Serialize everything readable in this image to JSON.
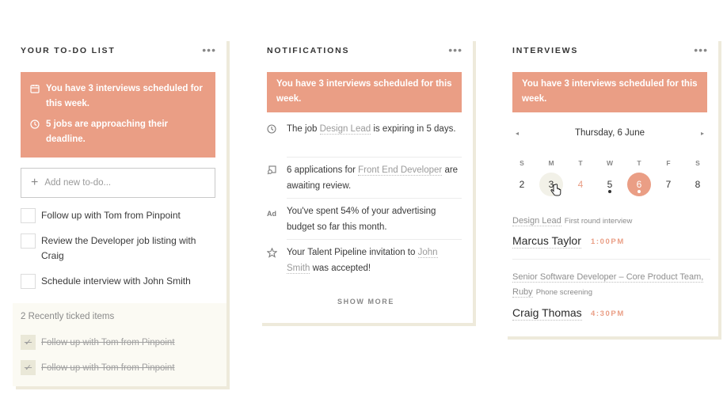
{
  "todo": {
    "title": "YOUR TO-DO LIST",
    "menu_label": "•••",
    "banner": [
      {
        "icon": "calendar-icon",
        "text": "You have 3 interviews scheduled for this week."
      },
      {
        "icon": "clock-icon",
        "text": "5 jobs are approaching their deadline."
      }
    ],
    "add_placeholder": "Add new to-do...",
    "items": [
      "Follow up with Tom from Pinpoint",
      "Review the Developer job listing with Craig",
      "Schedule interview with John Smith"
    ],
    "ticked_label": "2 Recently ticked items",
    "ticked_items": [
      "Follow up with Tom from Pinpoint",
      "Follow up with Tom from Pinpoint"
    ]
  },
  "notifications": {
    "title": "NOTIFICATIONS",
    "menu_label": "•••",
    "banner": "You have 3 interviews scheduled for this week.",
    "items": [
      {
        "icon": "clock-icon",
        "before": "The job ",
        "link": "Design Lead",
        "after": " is expiring in 5 days."
      },
      {
        "icon": "applications-icon",
        "before": "6 applications for ",
        "link": "Front End Developer",
        "after": " are awaiting review."
      },
      {
        "icon": "ad-icon",
        "icon_text": "Ad",
        "before": "You've spent 54% of your advertising budget so far this month.",
        "link": "",
        "after": ""
      },
      {
        "icon": "star-icon",
        "before": "Your Talent Pipeline invitation to ",
        "link": "John Smith",
        "after": " was accepted!"
      }
    ],
    "show_more": "SHOW MORE"
  },
  "interviews": {
    "title": "INTERVIEWS",
    "menu_label": "•••",
    "banner": "You have 3 interviews scheduled for this week.",
    "calendar": {
      "prev": "◂",
      "next": "▸",
      "date_label": "Thursday, 6 June",
      "weekdays": [
        "S",
        "M",
        "T",
        "W",
        "T",
        "F",
        "S"
      ],
      "days": [
        "2",
        "3",
        "4",
        "5",
        "6",
        "7",
        "8"
      ],
      "selected_day": "6",
      "days_with_interviews": [
        "5",
        "6"
      ]
    },
    "entries": [
      {
        "role": "Design Lead",
        "type": "First round interview",
        "name": "Marcus Taylor",
        "time": "1:00PM"
      },
      {
        "role": "Senior Software Developer – Core Product Team, Ruby",
        "type": "Phone screening",
        "name": "Craig Thomas",
        "time": "4:30PM"
      }
    ]
  },
  "colors": {
    "accent": "#ea9e85",
    "card_shadow": "#eeeadb",
    "ticked_bg": "#fbfaf3"
  }
}
